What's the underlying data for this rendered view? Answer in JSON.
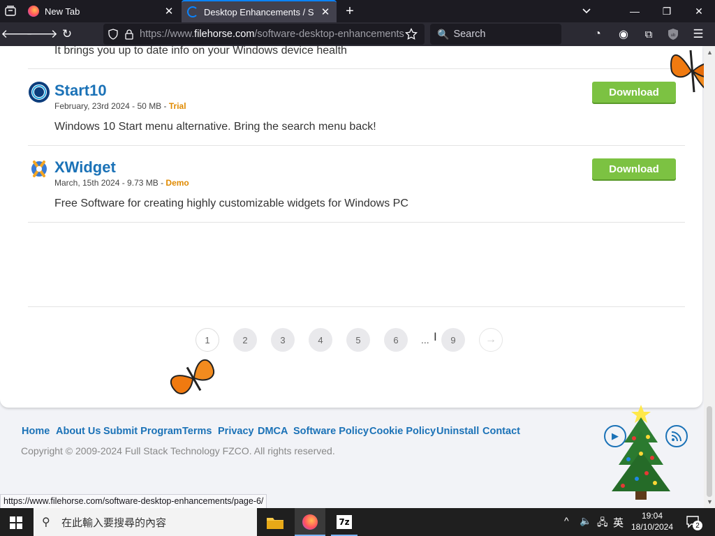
{
  "browser": {
    "tabs": [
      {
        "title": "New Tab"
      },
      {
        "title": "Desktop Enhancements / Software"
      }
    ],
    "url_prefix": "https://www.",
    "url_host": "filehorse.com",
    "url_path": "/software-desktop-enhancements",
    "search_placeholder": "Search"
  },
  "listing": {
    "prev_snippet": "It brings you up to date info on your Windows device health",
    "apps": [
      {
        "name": "Start10",
        "date_size": "February, 23rd 2024 - 50 MB - ",
        "license": "Trial",
        "description": "Windows 10 Start menu alternative. Bring the search menu back!",
        "download_label": "Download"
      },
      {
        "name": "XWidget",
        "date_size": "March, 15th 2024 - 9.73 MB - ",
        "license": "Demo",
        "description": "Free Software for creating highly customizable widgets for Windows PC",
        "download_label": "Download"
      }
    ]
  },
  "pagination": {
    "pages": [
      "1",
      "2",
      "3",
      "4",
      "5",
      "6"
    ],
    "ellipsis": "...",
    "last": "9",
    "next_arrow": "→"
  },
  "footer": {
    "links": [
      "Home",
      "About Us",
      "Submit Program",
      "Terms",
      "Privacy",
      "DMCA",
      "Software Policy",
      "Cookie Policy",
      "Uninstall",
      "Contact"
    ],
    "copyright": "Copyright © 2009-2024 Full Stack Technology FZCO. All rights reserved."
  },
  "status_url": "https://www.filehorse.com/software-desktop-enhancements/page-6/",
  "taskbar": {
    "search_placeholder": "在此輸入要搜尋的內容",
    "ime": "英",
    "time": "19:04",
    "date": "18/10/2024",
    "notification_count": "2"
  },
  "colors": {
    "accent": "#1b72b7",
    "download": "#7cc242",
    "license": "#e08a00",
    "firefox_tab_accent": "#0a84ff"
  }
}
